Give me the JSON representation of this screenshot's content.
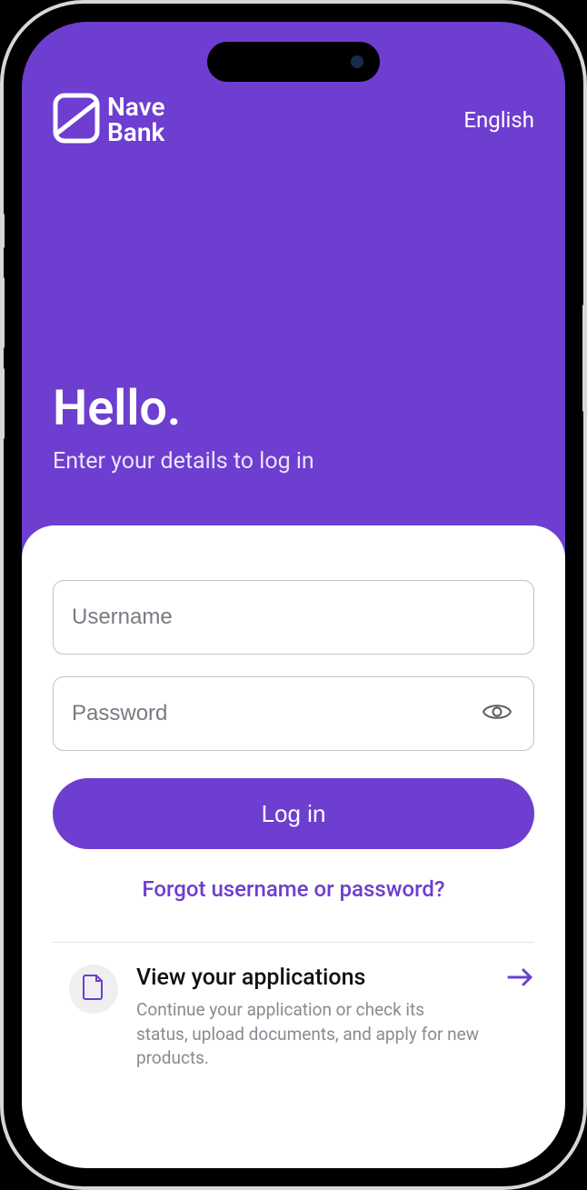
{
  "brand": {
    "name_line1": "Nave",
    "name_line2": "Bank",
    "logo": "nave-bank-logo"
  },
  "language": {
    "label": "English"
  },
  "hero": {
    "greeting": "Hello.",
    "subtitle": "Enter your details to log in"
  },
  "form": {
    "username_placeholder": "Username",
    "username_value": "",
    "password_placeholder": "Password",
    "password_value": "",
    "login_label": "Log in",
    "forgot_label": "Forgot username or password?"
  },
  "applications": {
    "title": "View your applications",
    "description": "Continue your application or check its status, upload documents, and apply for new products."
  },
  "colors": {
    "accent": "#6d3ecf",
    "card_bg": "#ffffff",
    "input_border": "#c2c2c6",
    "muted_text": "#8a8a92"
  },
  "icons": {
    "eye": "eye-icon",
    "document": "document-icon",
    "arrow_right": "arrow-right-icon"
  }
}
